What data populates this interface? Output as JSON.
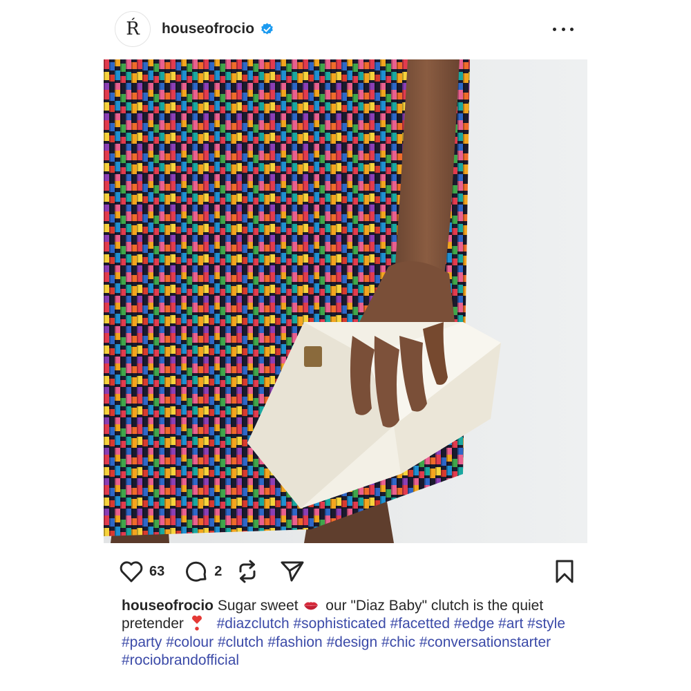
{
  "post": {
    "username": "houseofrocio",
    "avatar_letter": "Ŕ",
    "verified": true,
    "likes": "63",
    "comments": "2",
    "caption": {
      "text_1": "Sugar sweet",
      "text_2": "our \"Diaz Baby\" clutch is the quiet pretender",
      "emoji_1": "kiss-lips-emoji",
      "emoji_2": "heavy-heart-exclamation-emoji",
      "hashtags": [
        "#diazclutch",
        "#sophisticated",
        "#facetted",
        "#edge",
        "#art",
        "#style",
        "#party",
        "#colour",
        "#clutch",
        "#fashion",
        "#design",
        "#chic",
        "#conversationstarter",
        "#rociobrandofficial"
      ]
    }
  },
  "icons": {
    "verified": "verified-badge-icon",
    "more": "more-options-icon",
    "like": "heart-icon",
    "comment": "comment-icon",
    "repost": "repost-icon",
    "share": "share-icon",
    "save": "bookmark-icon"
  },
  "colors": {
    "text": "#262626",
    "hashtag": "#3b4aa8",
    "verified": "#1d9bf0",
    "lips": "#d62a3c"
  }
}
